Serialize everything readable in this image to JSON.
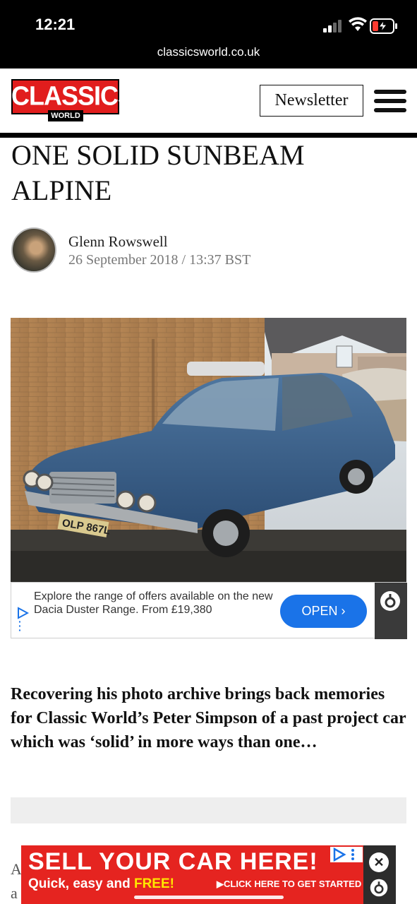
{
  "status_bar": {
    "time": "12:21",
    "url": "classicsworld.co.uk"
  },
  "header": {
    "logo_main": "CLASSICS",
    "logo_sub": "WORLD",
    "newsletter_label": "Newsletter",
    "menu_icon": "hamburger-menu-icon"
  },
  "article": {
    "title": "ONE SOLID SUNBEAM ALPINE",
    "author": "Glenn Rowswell",
    "date": "26 September 2018 / 13:37 BST",
    "photo_plate": "OLP 867L",
    "lead": "Recovering his photo archive brings back memories for Classic World’s Peter Simpson of a past project car which was ‘solid’ in more ways than one…",
    "para_start_1": "A",
    "para_start_2": "a"
  },
  "ad": {
    "text": "Explore the range of offers available on the new Dacia Duster Range. From £19,380",
    "open_label": "OPEN ›",
    "accent": "#1a73e8"
  },
  "banner_ad": {
    "headline": "SELL YOUR CAR HERE!",
    "sub_prefix": "Quick, easy and ",
    "sub_free": "FREE!",
    "cta": "▶CLICK HERE TO GET STARTED",
    "close": "✕",
    "color": "#e52420"
  }
}
